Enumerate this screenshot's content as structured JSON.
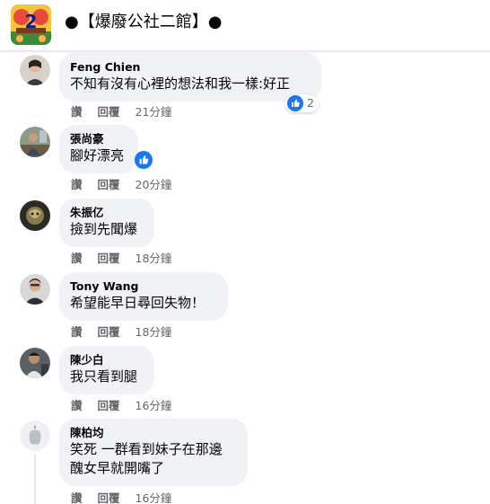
{
  "group": {
    "name": "●【爆廢公社二館】●",
    "avatar_text": "2"
  },
  "comments": [
    {
      "author": "Feng Chien",
      "text": "不知有沒有心裡的想法和我一樣:好正",
      "actions": [
        "讚",
        "回覆"
      ],
      "time": "21分鐘",
      "reactions": "2"
    },
    {
      "author": "張尚豪",
      "text": "腳好漂亮",
      "actions": [
        "讚",
        "回覆"
      ],
      "time": "20分鐘"
    },
    {
      "author": "朱振亿",
      "text": "撿到先聞爆",
      "actions": [
        "讚",
        "回覆"
      ],
      "time": "18分鐘"
    },
    {
      "author": "Tony Wang",
      "text": "希望能早日尋回失物！",
      "actions": [
        "讚",
        "回覆"
      ],
      "time": "18分鐘"
    },
    {
      "author": "陳少白",
      "text": "我只看到腿",
      "actions": [
        "讚",
        "回覆"
      ],
      "time": "16分鐘"
    },
    {
      "author": "陳柏均",
      "text_lines": [
        "笑死 一群看到妹子在那邊",
        "醜女早就開嘴了"
      ],
      "actions": [
        "讚",
        "回覆"
      ],
      "time": "16分鐘"
    }
  ],
  "colors": {
    "bubble": "#f0f2f5",
    "like_blue": "#1877f2",
    "meta_gray": "#65676b"
  }
}
